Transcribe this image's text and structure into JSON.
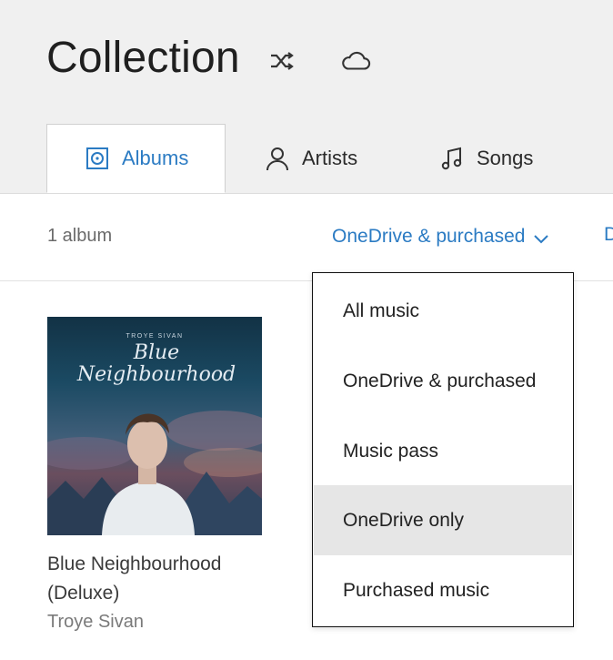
{
  "header": {
    "title": "Collection",
    "icons": [
      "shuffle-icon",
      "cloud-icon"
    ]
  },
  "tabs": [
    {
      "label": "Albums",
      "icon": "album-icon",
      "active": true
    },
    {
      "label": "Artists",
      "icon": "person-icon",
      "active": false
    },
    {
      "label": "Songs",
      "icon": "music-note-icon",
      "active": false
    }
  ],
  "toolbar": {
    "count": "1 album",
    "filter_label": "OneDrive & purchased",
    "edge_link": "D"
  },
  "albums": [
    {
      "title": "Blue Neighbourhood (Deluxe)",
      "title_line1": "Blue Neighbourhood",
      "title_line2": "(Deluxe)",
      "artist": "Troye Sivan",
      "cover_text_top": "TROYE SIVAN",
      "cover_text_script": "Blue Neighbourhood"
    }
  ],
  "dropdown": {
    "items": [
      "All music",
      "OneDrive & purchased",
      "Music pass",
      "OneDrive only",
      "Purchased music"
    ],
    "highlighted": "OneDrive only"
  },
  "colors": {
    "accent": "#2b7bc3",
    "header_bg": "#f0f0f0",
    "highlight": "#e6e6e6"
  }
}
